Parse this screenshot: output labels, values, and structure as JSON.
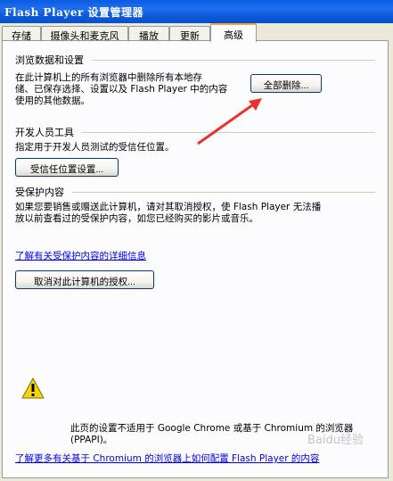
{
  "window": {
    "title": "Flash Player 设置管理器"
  },
  "tabs": [
    {
      "label": "存储"
    },
    {
      "label": "摄像头和麦克风"
    },
    {
      "label": "播放"
    },
    {
      "label": "更新"
    },
    {
      "label": "高级",
      "active": true
    }
  ],
  "browsing": {
    "title": "浏览数据和设置",
    "desc": [
      "在此计算机上的所有浏览器中删除所有本地存",
      "储、已保存选择、设置以及 Flash Player 中的内容",
      "使用的其他数据。"
    ],
    "delete_all_button": "全部删除..."
  },
  "developer": {
    "title": "开发人员工具",
    "desc": "指定用于开发人员测试的受信任位置。",
    "trusted_button": "受信任位置设置..."
  },
  "protected": {
    "title": "受保护内容",
    "desc": [
      "如果您要销售或赠送此计算机，请对其取消授权，使 Flash Player 无法播",
      "放以前查看过的受保护内容，如您已经购买的影片或音乐。"
    ],
    "more_link": "了解有关受保护内容的详细信息",
    "deauth_button": "取消对此计算机的授权..."
  },
  "notice": {
    "icon": "warning-icon",
    "lines": [
      "此页的设置不适用于 Google Chrome 或基于 Chromium 的浏览器",
      "(PPAPI)。"
    ],
    "link": "了解更多有关基于 Chromium 的浏览器上如何配置 Flash Player 的内容"
  },
  "watermark": "Baidu经验",
  "colors": {
    "titlebar": "#0a5ce0",
    "panel_bg": "#fcfcfe",
    "window_bg": "#ece9d8",
    "active_tab_accent": "#f2a53a",
    "link": "#0000ee",
    "arrow": "#e8322b"
  }
}
